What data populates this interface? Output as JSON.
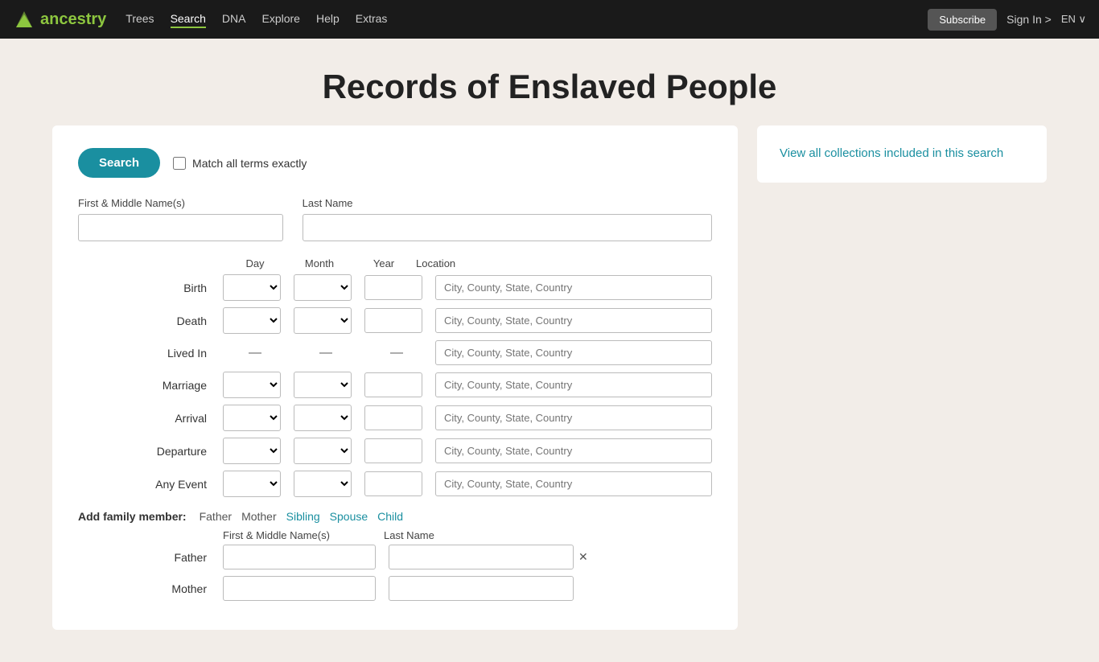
{
  "nav": {
    "logo_text": "ancestry",
    "links": [
      {
        "label": "Trees",
        "active": false
      },
      {
        "label": "Search",
        "active": true
      },
      {
        "label": "DNA",
        "active": false
      },
      {
        "label": "Explore",
        "active": false
      },
      {
        "label": "Help",
        "active": false
      },
      {
        "label": "Extras",
        "active": false
      }
    ],
    "subscribe_label": "Subscribe",
    "signin_label": "Sign In >",
    "lang_label": "EN ∨"
  },
  "page": {
    "title": "Records of Enslaved People"
  },
  "search_panel": {
    "search_button": "Search",
    "match_label": "Match all terms exactly",
    "first_middle_label": "First & Middle Name(s)",
    "last_name_label": "Last Name",
    "event_headers": {
      "day": "Day",
      "month": "Month",
      "year": "Year",
      "location": "Location"
    },
    "events": [
      {
        "label": "Birth"
      },
      {
        "label": "Death"
      },
      {
        "label": "Lived In",
        "dashes": true
      },
      {
        "label": "Marriage"
      },
      {
        "label": "Arrival"
      },
      {
        "label": "Departure"
      },
      {
        "label": "Any Event"
      }
    ],
    "location_placeholder": "City, County, State, Country",
    "family_section_label": "Add family member:",
    "family_links": [
      {
        "label": "Father",
        "active": false
      },
      {
        "label": "Mother",
        "active": false
      },
      {
        "label": "Sibling",
        "active": true
      },
      {
        "label": "Spouse",
        "active": true
      },
      {
        "label": "Child",
        "active": true
      }
    ],
    "family_col_first": "First & Middle Name(s)",
    "family_col_last": "Last Name",
    "family_members": [
      {
        "label": "Father"
      },
      {
        "label": "Mother"
      }
    ]
  },
  "sidebar": {
    "collections_link": "View all collections included in this search"
  }
}
